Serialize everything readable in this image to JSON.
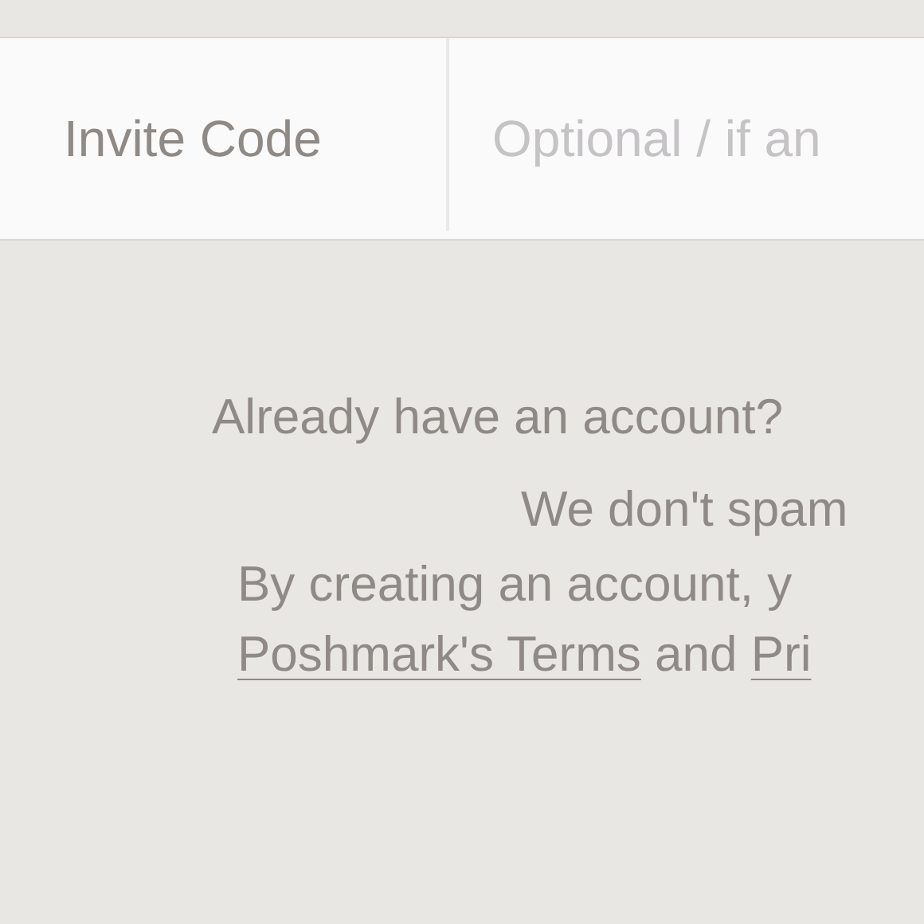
{
  "invite_field": {
    "label": "Invite Code",
    "placeholder": "Optional / if an"
  },
  "login_prompt": "Already have an account?",
  "spam_note": "We don't spam",
  "legal": {
    "intro": "By creating an account, y",
    "terms_link": "Poshmark's Terms",
    "joiner": "and",
    "privacy_link": "Pri"
  }
}
